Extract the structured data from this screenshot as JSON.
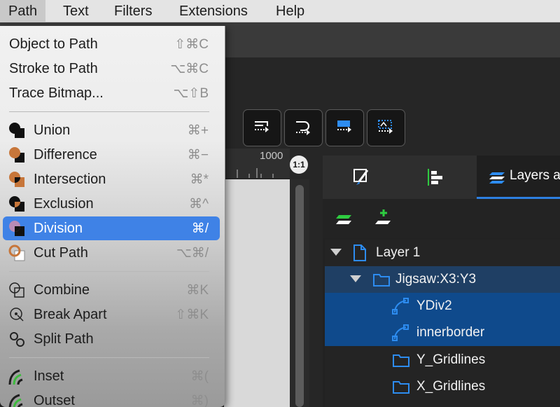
{
  "menubar": {
    "items": [
      {
        "label": "Path",
        "active": true
      },
      {
        "label": "Text"
      },
      {
        "label": "Filters"
      },
      {
        "label": "Extensions"
      },
      {
        "label": "Help"
      }
    ]
  },
  "path_menu": {
    "items": [
      {
        "label": "Object to Path",
        "shortcut": "⇧⌘C"
      },
      {
        "label": "Stroke to Path",
        "shortcut": "⌥⌘C"
      },
      {
        "label": "Trace Bitmap...",
        "shortcut": "⌥⇧B"
      },
      {
        "label": "Union",
        "shortcut": "⌘+",
        "icon": "union-icon"
      },
      {
        "label": "Difference",
        "shortcut": "⌘−",
        "icon": "difference-icon"
      },
      {
        "label": "Intersection",
        "shortcut": "⌘*",
        "icon": "intersection-icon"
      },
      {
        "label": "Exclusion",
        "shortcut": "⌘^",
        "icon": "exclusion-icon"
      },
      {
        "label": "Division",
        "shortcut": "⌘/",
        "icon": "division-icon",
        "highlighted": true
      },
      {
        "label": "Cut Path",
        "shortcut": "⌥⌘/",
        "icon": "cut-path-icon"
      },
      {
        "label": "Combine",
        "shortcut": "⌘K",
        "icon": "combine-icon"
      },
      {
        "label": "Break Apart",
        "shortcut": "⇧⌘K",
        "icon": "break-apart-icon"
      },
      {
        "label": "Split Path",
        "shortcut": "",
        "icon": "split-path-icon"
      },
      {
        "label": "Inset",
        "shortcut": "⌘(",
        "icon": "inset-icon"
      },
      {
        "label": "Outset",
        "shortcut": "⌘)",
        "icon": "outset-icon"
      }
    ]
  },
  "ruler": {
    "label": "1000"
  },
  "zoom_badge": "1:1",
  "dock": {
    "tabs": [
      {
        "icon": "fill-stroke-icon"
      },
      {
        "icon": "align-distribute-icon"
      },
      {
        "icon": "layers-icon",
        "label": "Layers a",
        "active": true
      }
    ],
    "tools": [
      {
        "icon": "add-layer-icon"
      },
      {
        "icon": "add-sublayer-icon"
      }
    ]
  },
  "layers": {
    "rows": [
      {
        "label": "Layer 1",
        "icon": "layer-page-icon",
        "expanded": true
      },
      {
        "label": "Jigsaw:X3:Y3",
        "icon": "folder-icon",
        "expanded": true
      },
      {
        "label": "YDiv2",
        "icon": "path-node-icon"
      },
      {
        "label": "innerborder",
        "icon": "path-node-icon"
      },
      {
        "label": "Y_Gridlines",
        "icon": "folder-icon"
      },
      {
        "label": "X_Gridlines",
        "icon": "folder-icon"
      }
    ]
  },
  "colors": {
    "accent": "#3f82e6",
    "selection": "#0f4a8c",
    "icon_blue": "#2d8cf0"
  }
}
